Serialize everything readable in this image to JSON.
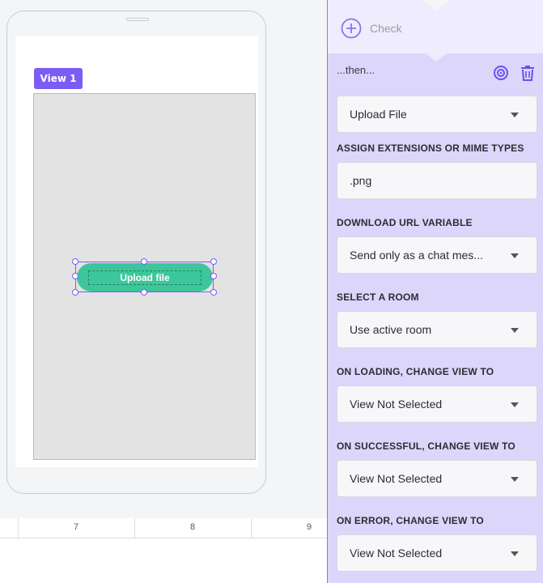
{
  "canvas": {
    "view_tag": "View 1",
    "upload_button_label": "Upload file",
    "ruler_labels": [
      "7",
      "8",
      "9"
    ]
  },
  "panel": {
    "check_label": "Check",
    "then_label": "...then...",
    "action_select": "Upload File",
    "sections": [
      {
        "label": "ASSIGN EXTENSIONS OR MIME TYPES",
        "value": ".png",
        "type": "input"
      },
      {
        "label": "DOWNLOAD URL VARIABLE",
        "value": "Send only as a chat mes...",
        "type": "select"
      },
      {
        "label": "SELECT A ROOM",
        "value": "Use active room",
        "type": "select"
      },
      {
        "label": "ON LOADING, CHANGE VIEW TO",
        "value": "View Not Selected",
        "type": "select"
      },
      {
        "label": "ON SUCCESSFUL, CHANGE VIEW TO",
        "value": "View Not Selected",
        "type": "select"
      },
      {
        "label": "ON ERROR, CHANGE VIEW TO",
        "value": "View Not Selected",
        "type": "select"
      }
    ]
  },
  "colors": {
    "accent": "#7b5cf5",
    "upload_button": "#3bc79a",
    "panel_bg": "#dcd6fb"
  },
  "icons": {
    "check_add": "plus-circle-icon",
    "target": "target-icon",
    "delete": "trash-icon"
  }
}
